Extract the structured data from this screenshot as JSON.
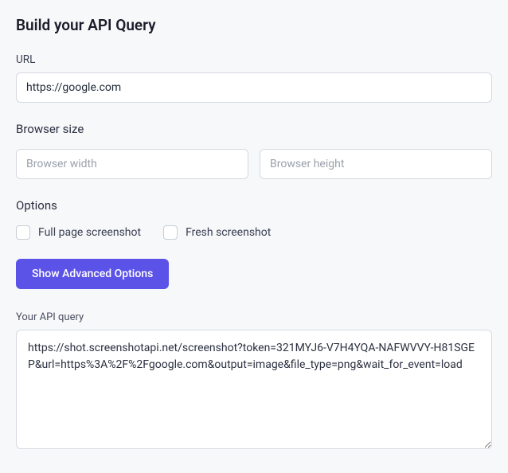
{
  "heading": "Build your API Query",
  "url": {
    "label": "URL",
    "value": "https://google.com"
  },
  "browser_size": {
    "label": "Browser size",
    "width_placeholder": "Browser width",
    "height_placeholder": "Browser height"
  },
  "options": {
    "label": "Options",
    "full_page_label": "Full page screenshot",
    "fresh_label": "Fresh screenshot"
  },
  "advanced_button": "Show Advanced Options",
  "query": {
    "label": "Your API query",
    "value": "https://shot.screenshotapi.net/screenshot?token=321MYJ6-V7H4YQA-NAFWVVY-H81SGEP&url=https%3A%2F%2Fgoogle.com&output=image&file_type=png&wait_for_event=load"
  }
}
